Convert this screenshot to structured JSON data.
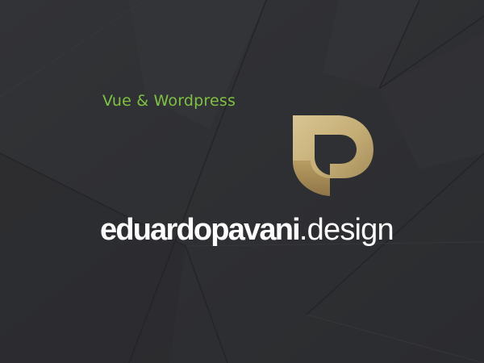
{
  "colors": {
    "background": "#2f3033",
    "accent_green": "#7fc241",
    "logo_gold": "#c9b27c",
    "wordmark": "#ffffff"
  },
  "tagline": "Vue & Wordpress",
  "logo": {
    "icon": "pd-monogram-icon",
    "brand_name": "eduardopavani",
    "domain_suffix": ".design"
  }
}
